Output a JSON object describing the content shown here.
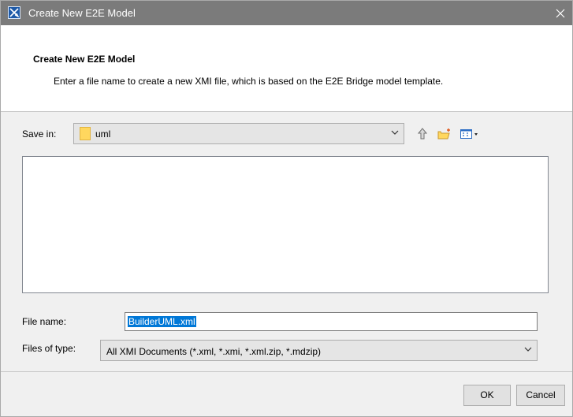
{
  "window": {
    "title": "Create New E2E Model"
  },
  "header": {
    "title": "Create New E2E Model",
    "description": "Enter a file name to create a new XMI file, which is based on the E2E Bridge model template."
  },
  "save_in": {
    "label": "Save in:",
    "value": "uml"
  },
  "toolbar": {
    "icons": [
      "up-folder-icon",
      "new-folder-icon",
      "view-menu-icon"
    ]
  },
  "file_name": {
    "label": "File name:",
    "value": "BuilderUML.xml"
  },
  "files_of_type": {
    "label": "Files of type:",
    "value": "All XMI Documents (*.xml, *.xmi, *.xml.zip, *.mdzip)"
  },
  "buttons": {
    "ok": "OK",
    "cancel": "Cancel"
  },
  "colors": {
    "titlebar": "#7b7b7b",
    "selection": "#0078d7",
    "folder": "#ffd75e"
  }
}
